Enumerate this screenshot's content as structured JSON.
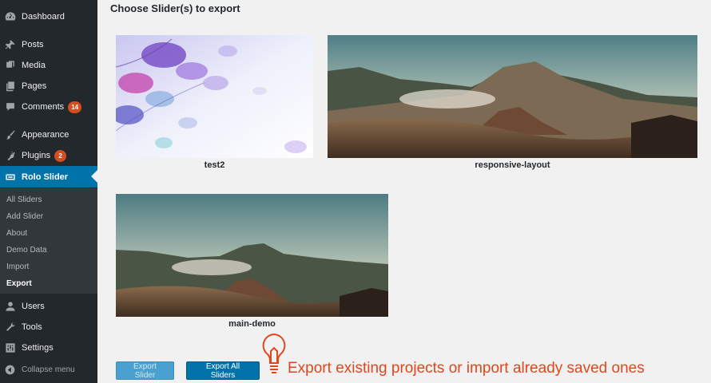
{
  "sidebar": {
    "items": [
      {
        "label": "Dashboard",
        "icon": "dashboard-icon"
      },
      {
        "label": "Posts",
        "icon": "pushpin-icon"
      },
      {
        "label": "Media",
        "icon": "media-icon"
      },
      {
        "label": "Pages",
        "icon": "pages-icon"
      },
      {
        "label": "Comments",
        "icon": "comment-icon",
        "badge": "14"
      },
      {
        "label": "Appearance",
        "icon": "paintbrush-icon"
      },
      {
        "label": "Plugins",
        "icon": "plugin-icon",
        "badge": "2"
      },
      {
        "label": "Rolo Slider",
        "icon": "slider-icon",
        "active": true
      },
      {
        "label": "Users",
        "icon": "users-icon"
      },
      {
        "label": "Tools",
        "icon": "wrench-icon"
      },
      {
        "label": "Settings",
        "icon": "settings-icon"
      }
    ],
    "submenu": [
      "All Sliders",
      "Add Slider",
      "About",
      "Demo Data",
      "Import",
      "Export"
    ],
    "current_submenu": "Export",
    "collapse_label": "Collapse menu"
  },
  "main": {
    "heading": "Choose Slider(s) to export",
    "sliders": [
      {
        "name": "test2"
      },
      {
        "name": "responsive-layout"
      },
      {
        "name": "main-demo"
      }
    ],
    "export_button": "Export Slider",
    "export_all_button": "Export All Sliders"
  },
  "promo": {
    "text": "Export existing projects or import already saved ones",
    "icon": "lightbulb-icon"
  },
  "colors": {
    "sidebar_bg": "#23282d",
    "active_bg": "#0073aa",
    "badge": "#d54e21",
    "promo": "#e2461c"
  }
}
